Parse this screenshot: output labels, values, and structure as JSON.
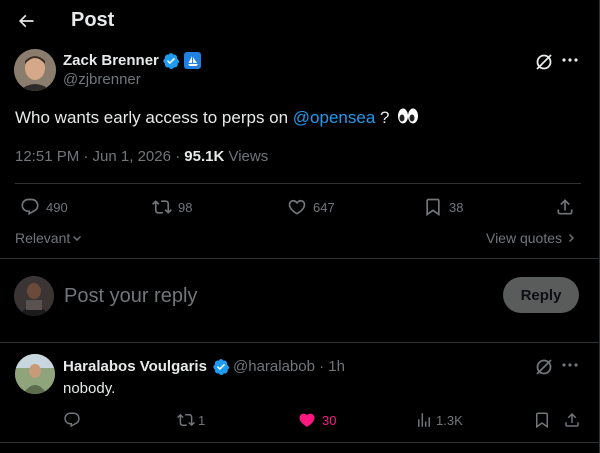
{
  "header": {
    "title": "Post"
  },
  "post": {
    "author_name": "Zack Brenner",
    "author_handle": "@zjbrenner",
    "text_before": "Who wants early access to perps on ",
    "mention": "@opensea",
    "text_after": " ?",
    "time": "12:51 PM · Jun 1, 2026 · ",
    "views_count": "95.1K",
    "views_label": " Views",
    "replies": "490",
    "reposts": "98",
    "likes": "647",
    "bookmarks": "38"
  },
  "sort": {
    "label": "Relevant"
  },
  "view_quotes": {
    "label": "View quotes"
  },
  "composer": {
    "placeholder": "Post your reply",
    "button": "Reply"
  },
  "reply": {
    "author_name": "Haralabos Voulgaris",
    "author_handle": "@haralabob · 1h",
    "text": "nobody.",
    "reposts": "1",
    "likes": "30",
    "views": "1.3K"
  },
  "colors": {
    "accent": "#1d9bf0",
    "like": "#f91880",
    "muted": "#71767b",
    "divider": "#2f3336"
  }
}
